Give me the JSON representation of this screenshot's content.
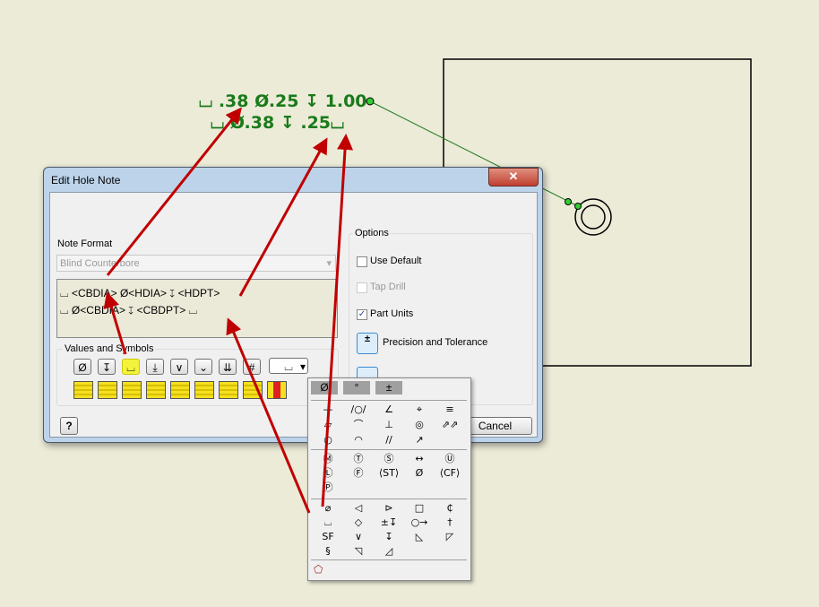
{
  "note": {
    "line1": "⌴ .38 Ø.25 ↧ 1.00",
    "line2": "⌴ Ø.38 ↧ .25⌴"
  },
  "dialog": {
    "title": "Edit Hole Note",
    "close": "✕",
    "note_format_label": "Note Format",
    "format_value": "Blind Counterbore",
    "format_text_line1": "⌴ <CBDIA> Ø<HDIA> ↧ <HDPT>",
    "format_text_line2": "⌴ Ø<CBDIA> ↧ <CBDPT> ⌴",
    "values_symbols_label": "Values and Symbols",
    "symbol_buttons": [
      "Ø",
      "↧",
      "⌴",
      "⤓",
      "∨",
      "⌄",
      "⇊",
      "#"
    ],
    "symbol_dropdown_value": "⌴",
    "options_label": "Options",
    "use_default": "Use Default",
    "tap_drill": "Tap Drill",
    "part_units": "Part Units",
    "use_default_checked": false,
    "tap_drill_checked": false,
    "part_units_checked": true,
    "precision_tolerance": "Precision and Tolerance",
    "cancel": "Cancel",
    "help": "?"
  },
  "palette": {
    "tabs": [
      "Ø",
      "°",
      "±"
    ],
    "group1": [
      "—",
      "/○/",
      "∠",
      "⌖",
      "≡",
      "▱",
      "⌒",
      "⊥",
      "◎",
      "⇗⇗",
      "○",
      "◠",
      "//",
      "↗"
    ],
    "group2": [
      "Ⓜ",
      "Ⓣ",
      "Ⓢ",
      "↔",
      "Ⓤ",
      "Ⓛ",
      "Ⓕ",
      "⟨ST⟩",
      "Ø",
      "⟨CF⟩",
      "Ⓟ"
    ],
    "group3": [
      "⌀",
      "◁",
      "⊳",
      "□",
      "₵",
      "⌴",
      "◇",
      "±↧",
      "○→",
      "†",
      "SF",
      "∨",
      "↧",
      "◺",
      "◸",
      "§",
      "◹",
      "◿"
    ]
  },
  "colors": {
    "accent": "#1a7a1a",
    "arrow": "#c00000"
  }
}
